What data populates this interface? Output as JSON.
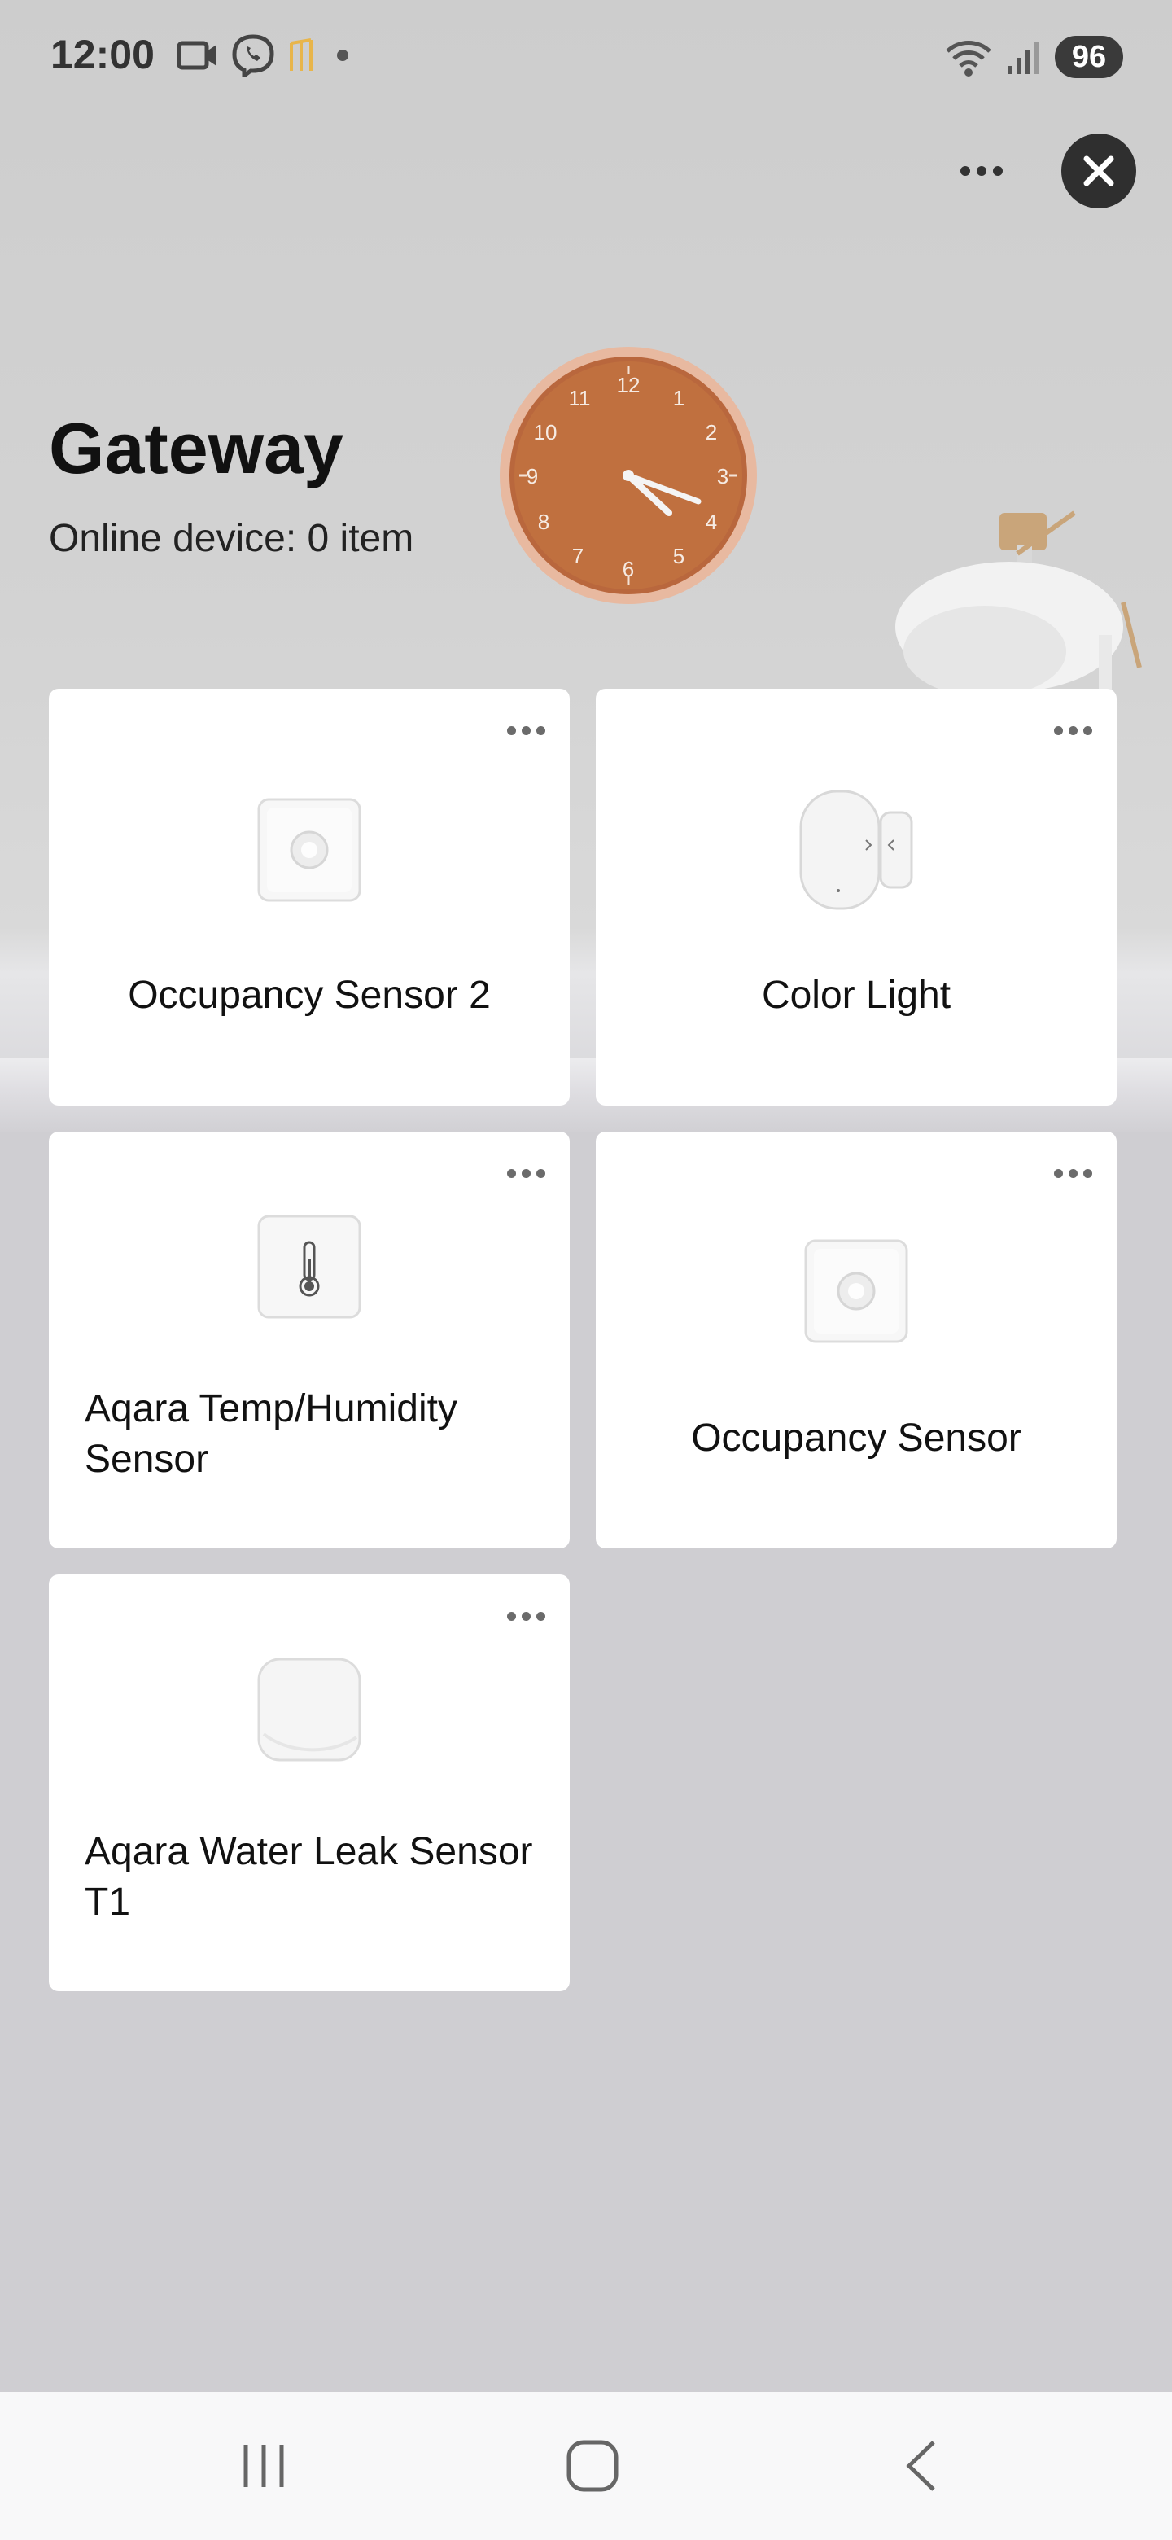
{
  "status_bar": {
    "time": "12:00",
    "battery": "96",
    "left_icons": [
      "video-call-icon",
      "viber-icon",
      "app-notification-icon",
      "dot-icon"
    ],
    "right_icons": [
      "wifi-icon",
      "signal-icon"
    ]
  },
  "header": {
    "title": "Gateway",
    "subtitle": "Online device: 0 item"
  },
  "devices": [
    {
      "name": "Occupancy Sensor 2",
      "icon": "occupancy-sensor-icon"
    },
    {
      "name": "Color Light",
      "icon": "door-sensor-icon"
    },
    {
      "name": "Aqara Temp/Humidity Sensor",
      "icon": "thermometer-icon"
    },
    {
      "name": "Occupancy Sensor",
      "icon": "occupancy-sensor-icon"
    },
    {
      "name": "Aqara Water Leak Sensor T1",
      "icon": "water-leak-sensor-icon"
    }
  ],
  "nav": [
    "recent-apps-icon",
    "home-icon",
    "back-icon"
  ],
  "colors": {
    "background": "#cfced2",
    "card": "#ffffff",
    "close_button": "#2f2f2f",
    "battery_pill": "#3a3a3a"
  }
}
